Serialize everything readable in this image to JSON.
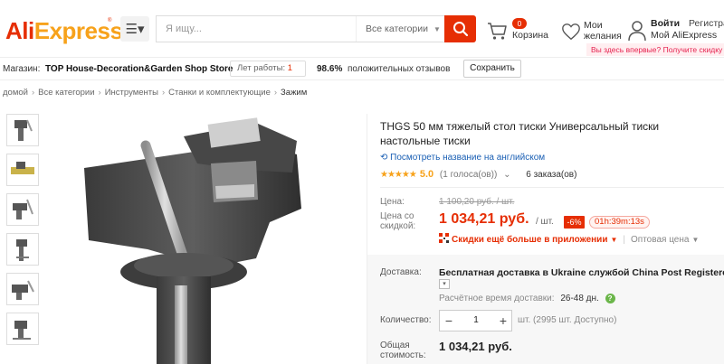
{
  "header": {
    "logo_part1": "Ali",
    "logo_part2": "Express",
    "logo_tm": "®",
    "search_placeholder": "Я ищу...",
    "category_select": "Все категории",
    "cart_count": "0",
    "cart_label": "Корзина",
    "wishlist_label": "Мои желания",
    "login_label": "Войти",
    "register_label": "Регистрация",
    "my_account_label": "Мой AliExpress",
    "first_visit_text": "Вы здесь впервые? Получите скидку"
  },
  "store": {
    "label": "Магазин:",
    "name": "TOP House-Decoration&Garden Shop Store",
    "years_label": "Лет работы:",
    "years_value": "1",
    "positive_pct": "98.6%",
    "positive_label": "положительных отзывов",
    "save_button": "Сохранить"
  },
  "breadcrumb": {
    "items": [
      "домой",
      "Все категории",
      "Инструменты",
      "Станки и комплектующие"
    ],
    "current": "Зажим"
  },
  "product": {
    "title": "THGS 50 мм тяжелый стол тиски Универсальный тиски настольные тиски",
    "translate_link": "Посмотреть название на английском",
    "stars": "★★★★★",
    "rating": "5.0",
    "votes": "(1 голоса(ов))",
    "orders": "6 заказа(ов)",
    "price_label": "Цена:",
    "old_price": "1 100,20 руб. / шт.",
    "discount_price_label": "Цена со скидкой:",
    "new_price": "1 034,21 руб.",
    "per_unit": "/ шт.",
    "discount_badge": "-6%",
    "timer": "01h:39m:13s",
    "app_discount": "Скидки ещё больше в приложении",
    "bulk_price": "Оптовая цена",
    "shipping_label": "Доставка:",
    "shipping_text": "Бесплатная доставка в Ukraine службой China Post Registered Air Mail",
    "estimated_label": "Расчётное время доставки:",
    "estimated_days": "26-48 дн.",
    "quantity_label": "Количество:",
    "quantity_value": "1",
    "quantity_available": "шт. (2995 шт. Доступно)",
    "total_label": "Общая стоимость:",
    "total_value": "1 034,21 руб."
  },
  "colors": {
    "brand_red": "#e62e04",
    "brand_orange": "#f7a21b",
    "link_blue": "#1a5fb4"
  }
}
